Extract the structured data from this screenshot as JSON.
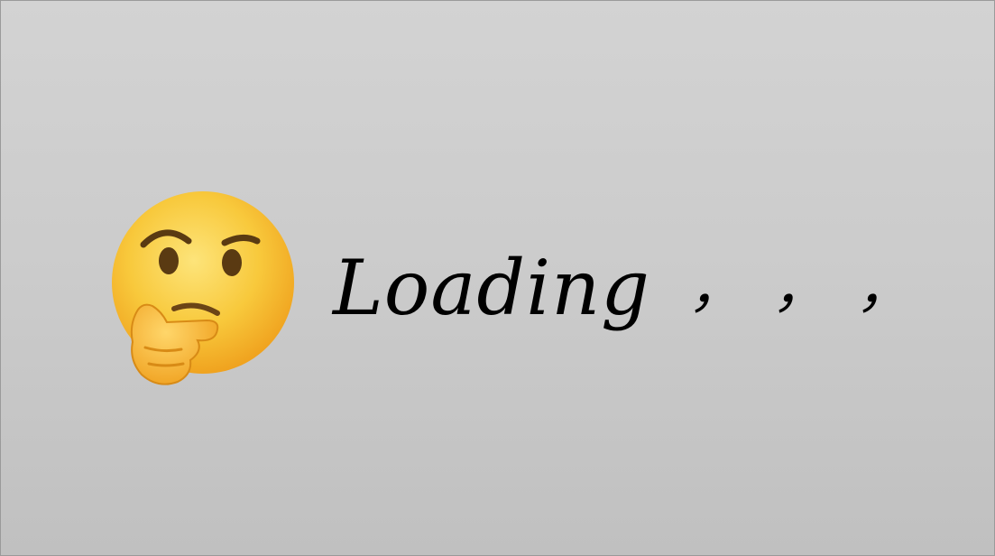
{
  "loading": {
    "emoji_icon": "thinking-face-icon",
    "label": "Loading",
    "dots": [
      "，",
      "，",
      "，"
    ]
  },
  "colors": {
    "background_top": "#d3d3d3",
    "background_bottom": "#c0c0c0",
    "text": "#000000",
    "emoji_face": "#f7c23a"
  }
}
